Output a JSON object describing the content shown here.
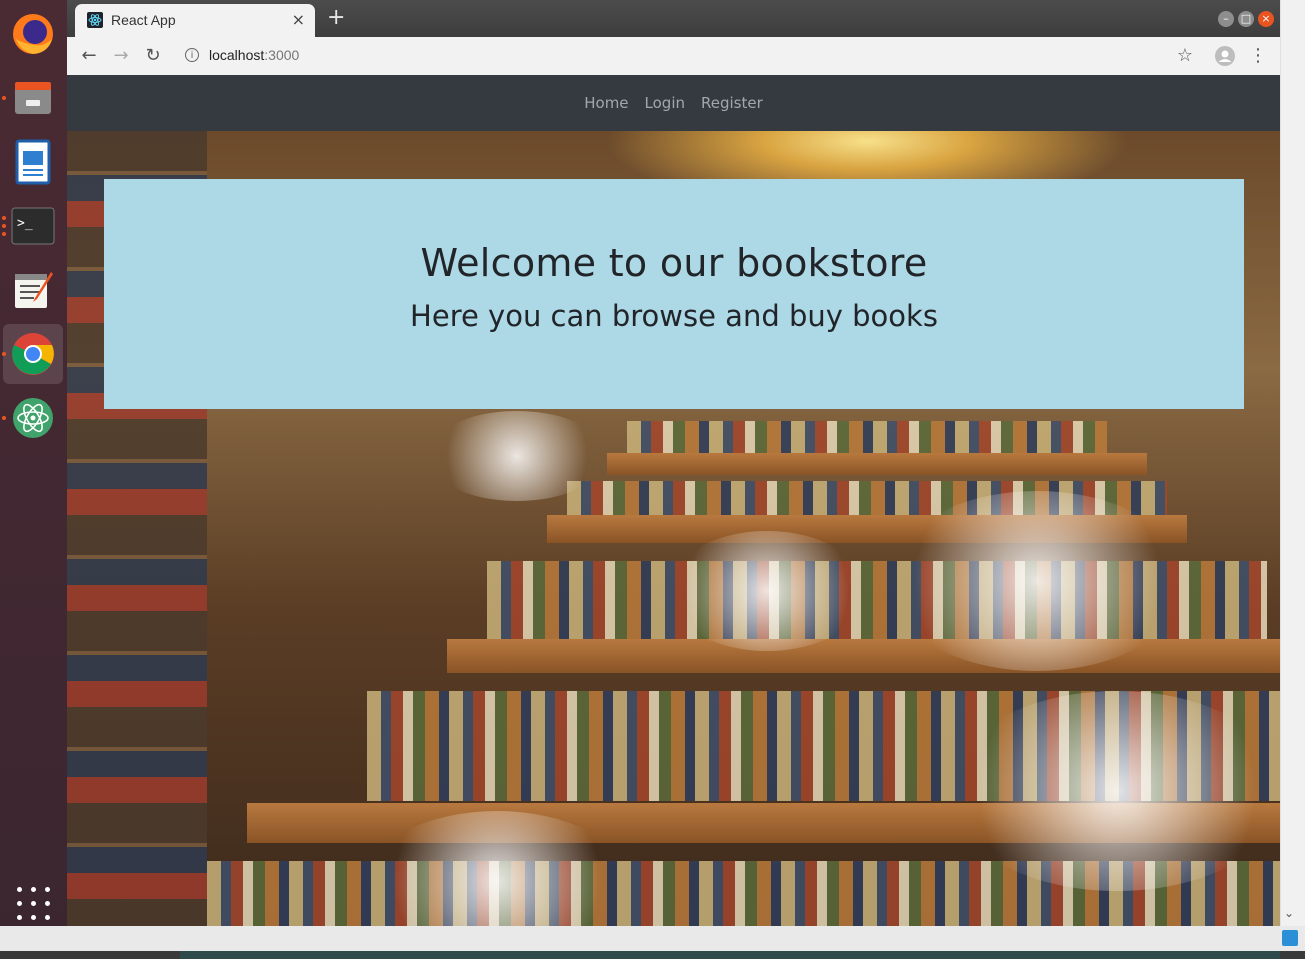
{
  "browser": {
    "tab_title": "React App",
    "tab_close": "×",
    "new_tab": "+",
    "url_host": "localhost",
    "url_port": ":3000"
  },
  "navbar": {
    "items": [
      {
        "label": "Home"
      },
      {
        "label": "Login"
      },
      {
        "label": "Register"
      }
    ]
  },
  "hero": {
    "title": "Welcome to our bookstore",
    "subtitle": "Here you can browse and buy books"
  },
  "colors": {
    "navbar_bg": "#343a40",
    "jumbotron_bg": "#add8e6",
    "dock_accent": "#e95420"
  },
  "dock": {
    "apps": [
      "firefox-icon",
      "files-icon",
      "writer-icon",
      "terminal-icon",
      "text-editor-icon",
      "chrome-icon",
      "atom-icon"
    ]
  }
}
